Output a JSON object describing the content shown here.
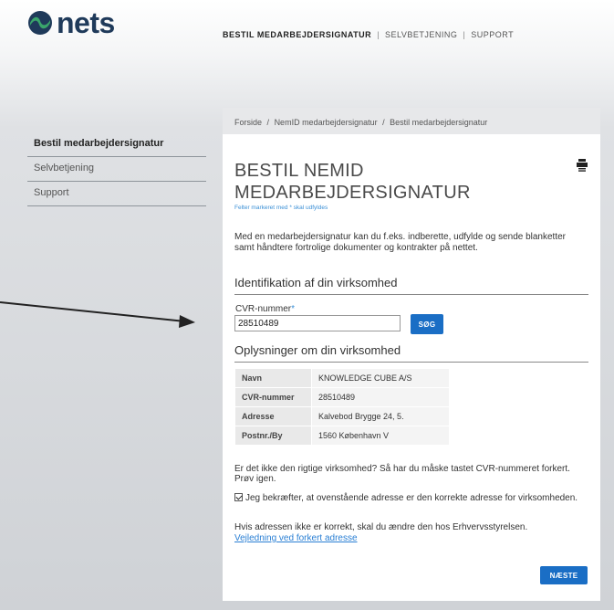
{
  "brand": {
    "name": "nets",
    "colors": {
      "primary": "#1f3a5a",
      "accent": "#1a6ec5",
      "logo_green": "#3aa56b"
    }
  },
  "topnav": {
    "items": [
      "BESTIL MEDARBEJDERSIGNATUR",
      "SELVBETJENING",
      "SUPPORT"
    ],
    "separator": "|"
  },
  "sidebar": {
    "items": [
      "Bestil medarbejdersignatur",
      "Selvbetjening",
      "Support"
    ]
  },
  "breadcrumb": {
    "items": [
      "Forside",
      "NemID medarbejdersignatur",
      "Bestil medarbejdersignatur"
    ],
    "separator": "/"
  },
  "page": {
    "title": "BESTIL NEMID MEDARBEJDERSIGNATUR",
    "required_note": "Felter markeret med * skal udfyldes",
    "intro": "Med en medarbejdersignatur kan du f.eks. indberette, udfylde og sende blanketter samt håndtere fortrolige dokumenter og kontrakter på nettet."
  },
  "identification": {
    "heading": "Identifikation af din virksomhed",
    "cvr_label": "CVR-nummer",
    "required_marker": "*",
    "cvr_value": "28510489",
    "search_button": "SØG"
  },
  "company_info": {
    "heading": "Oplysninger om din virksomhed",
    "rows": [
      {
        "key": "Navn",
        "value": "KNOWLEDGE CUBE A/S"
      },
      {
        "key": "CVR-nummer",
        "value": "28510489"
      },
      {
        "key": "Adresse",
        "value": "Kalvebod Brygge 24, 5."
      },
      {
        "key": "Postnr./By",
        "value": "1560 København V"
      }
    ]
  },
  "wrong_company_note": "Er det ikke den rigtige virksomhed? Så har du måske tastet CVR-nummeret forkert. Prøv igen.",
  "confirm_text": "Jeg bekræfter, at ovenstående adresse er den korrekte adresse for virksomheden.",
  "confirm_checked": true,
  "address_note": "Hvis adressen ikke er korrekt, skal du ændre den hos Erhvervsstyrelsen.",
  "address_link": "Vejledning ved forkert adresse",
  "next_button": "NÆSTE",
  "icons": {
    "print": "print-icon",
    "logo": "nets-logo-icon"
  }
}
